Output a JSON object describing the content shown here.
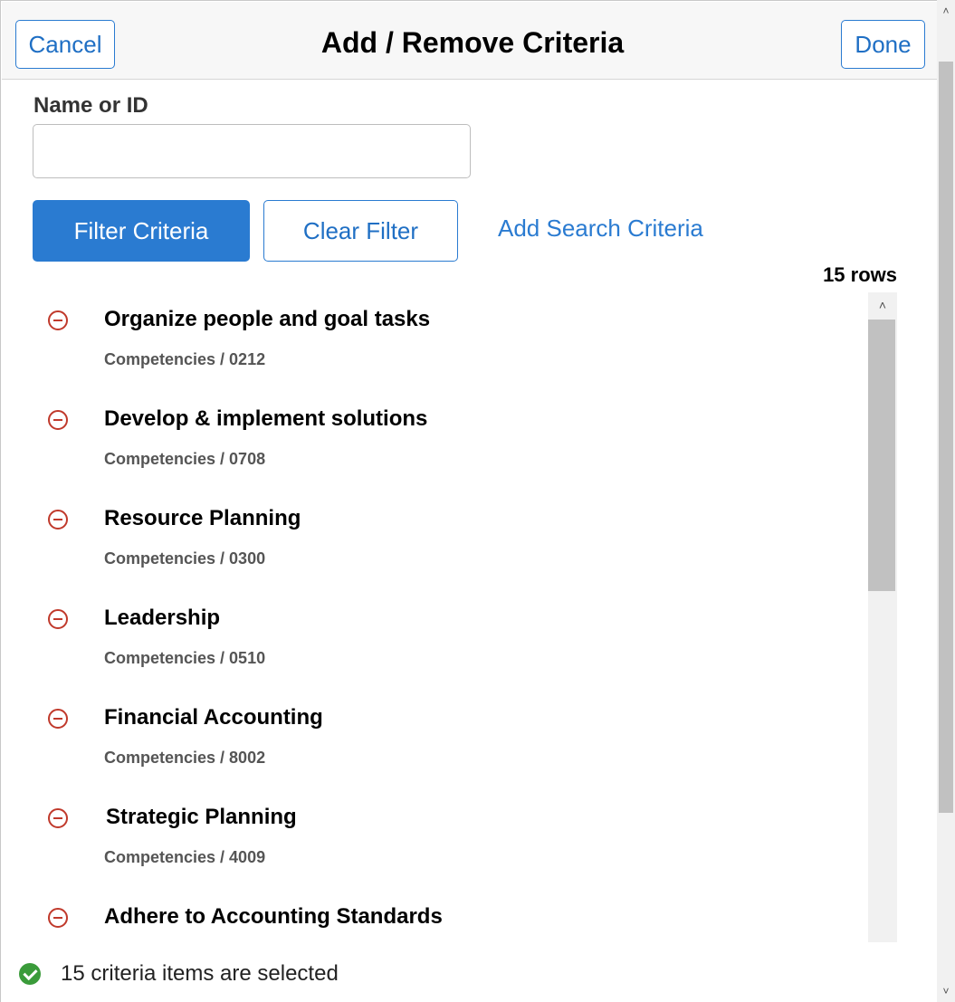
{
  "header": {
    "cancel_label": "Cancel",
    "title": "Add / Remove Criteria",
    "done_label": "Done"
  },
  "filter": {
    "name_label": "Name or ID",
    "name_value": "",
    "filter_button": "Filter Criteria",
    "clear_button": "Clear Filter",
    "add_link": "Add Search Criteria"
  },
  "list": {
    "rows_count": "15 rows",
    "items": [
      {
        "title": "Organize people and goal tasks",
        "sub": "Competencies / 0212"
      },
      {
        "title": "Develop & implement solutions",
        "sub": "Competencies / 0708"
      },
      {
        "title": "Resource Planning",
        "sub": "Competencies / 0300"
      },
      {
        "title": "Leadership",
        "sub": "Competencies / 0510"
      },
      {
        "title": "Financial Accounting",
        "sub": "Competencies / 8002"
      },
      {
        "title": "Strategic Planning",
        "sub": "Competencies / 4009"
      },
      {
        "title": "Adhere to Accounting Standards",
        "sub": ""
      }
    ]
  },
  "status": {
    "text": "15 criteria items are selected",
    "icon": "check-circle-icon",
    "color": "#3a9b3a"
  },
  "colors": {
    "accent": "#2a7bd1",
    "remove": "#c0392b"
  }
}
